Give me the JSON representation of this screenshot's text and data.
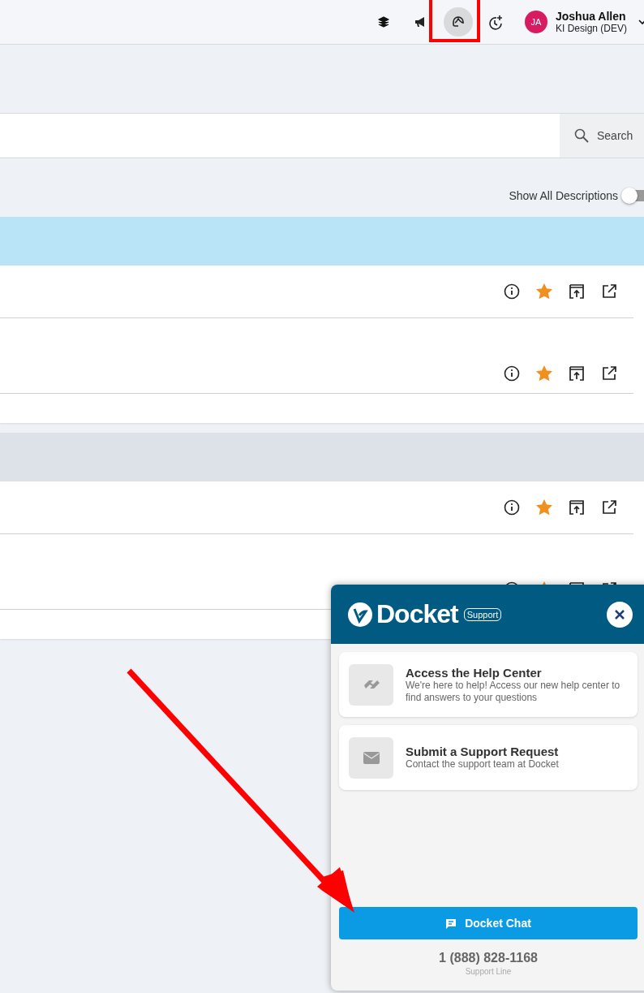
{
  "top_bar": {
    "icons": [
      {
        "kind": "layers",
        "selected": false
      },
      {
        "kind": "megaphone",
        "selected": false
      },
      {
        "kind": "support",
        "selected": true
      },
      {
        "kind": "history",
        "selected": false
      }
    ],
    "user": {
      "initials": "JA",
      "name": "Joshua Allen",
      "org": "KI Design (DEV)"
    }
  },
  "search": {
    "button": "Search"
  },
  "toggle": {
    "label": "Show All Descriptions",
    "on": false
  },
  "sections": [
    {
      "kind": "highlighted",
      "rows": [
        {
          "favorite": true
        },
        {
          "favorite": true
        }
      ]
    },
    {
      "kind": "plain",
      "rows": [
        {
          "favorite": true
        },
        {
          "favorite": true
        }
      ]
    }
  ],
  "support_panel": {
    "logo": "Docket",
    "badge": "Support",
    "options": [
      {
        "kind": "help",
        "title": "Access the Help Center",
        "text": "We're here to help! Access our new help center to find answers to your questions"
      },
      {
        "kind": "mail",
        "title": "Submit a Support Request",
        "text": "Contact the support team at Docket"
      }
    ],
    "chat_button": "Docket Chat",
    "phone": "1 (888) 828-1168",
    "phone_label": "Support Line"
  },
  "annotations": {
    "highlight_box": true,
    "arrow": true
  }
}
